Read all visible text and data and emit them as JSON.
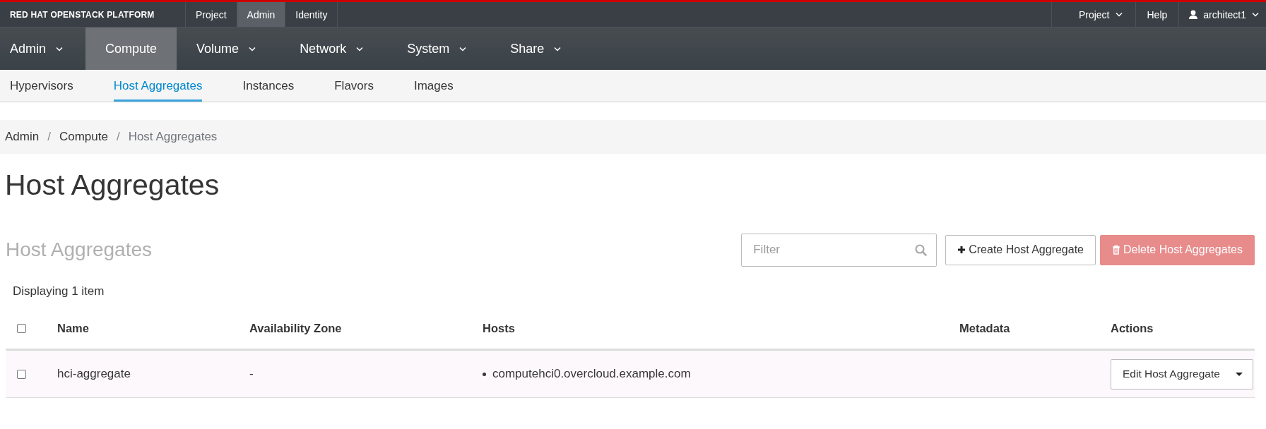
{
  "brand": "RED HAT OPENSTACK PLATFORM",
  "context_tabs": [
    {
      "label": "Project",
      "selected": false
    },
    {
      "label": "Admin",
      "selected": true
    },
    {
      "label": "Identity",
      "selected": false
    }
  ],
  "utility_menu": [
    {
      "label": "Project",
      "kind": "dropdown"
    },
    {
      "label": "Help",
      "kind": "link"
    },
    {
      "label": "architect1",
      "kind": "user"
    }
  ],
  "main_nav": [
    {
      "label": "Admin",
      "kind": "dropdown",
      "selected": false
    },
    {
      "label": "Compute",
      "kind": "link",
      "selected": true
    },
    {
      "label": "Volume",
      "kind": "dropdown",
      "selected": false
    },
    {
      "label": "Network",
      "kind": "dropdown",
      "selected": false
    },
    {
      "label": "System",
      "kind": "dropdown",
      "selected": false
    },
    {
      "label": "Share",
      "kind": "dropdown",
      "selected": false
    }
  ],
  "sub_nav": [
    {
      "label": "Hypervisors",
      "selected": false
    },
    {
      "label": "Host Aggregates",
      "selected": true
    },
    {
      "label": "Instances",
      "selected": false
    },
    {
      "label": "Flavors",
      "selected": false
    },
    {
      "label": "Images",
      "selected": false
    }
  ],
  "breadcrumb": {
    "separator": "/",
    "items": [
      "Admin",
      "Compute",
      "Host Aggregates"
    ]
  },
  "page_title": "Host Aggregates",
  "table": {
    "title": "Host Aggregates",
    "filter": {
      "placeholder": "Filter"
    },
    "actions": [
      {
        "label": "Create Host Aggregate",
        "kind": "create",
        "disabled": false
      },
      {
        "label": "Delete Host Aggregates",
        "kind": "delete",
        "disabled": true
      }
    ],
    "count_text": "Displaying 1 item",
    "select_all": {
      "checked": false
    },
    "columns": [
      "Name",
      "Availability Zone",
      "Hosts",
      "Metadata",
      "Actions"
    ],
    "rows": [
      {
        "checked": false,
        "name": "hci-aggregate",
        "availability_zone": "-",
        "hosts": [
          "computehci0.overcloud.example.com"
        ],
        "action": "Edit Host Aggregate"
      }
    ]
  }
}
